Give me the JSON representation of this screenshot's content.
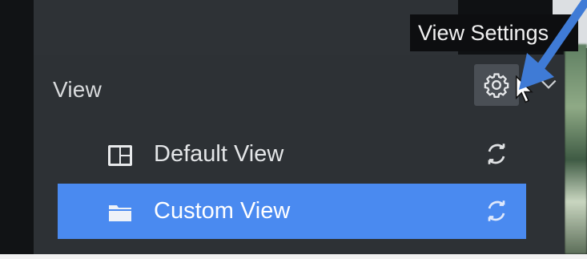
{
  "panel": {
    "title": "View"
  },
  "tooltip": {
    "text": "View Settings"
  },
  "rows": [
    {
      "label": "Default View",
      "icon": "layout-grid-icon",
      "selected": false
    },
    {
      "label": "Custom View",
      "icon": "folder-icon",
      "selected": true
    }
  ],
  "colors": {
    "panel_bg": "#2d3135",
    "selected_row": "#4a8af0",
    "annotation_arrow": "#3f7bd6",
    "tooltip_bg": "#0d0e10"
  },
  "icons": {
    "gear": "gear-icon",
    "chevron": "chevron-down-icon",
    "refresh": "refresh-icon",
    "cursor": "mouse-cursor-icon",
    "arrow": "annotation-arrow-icon"
  }
}
